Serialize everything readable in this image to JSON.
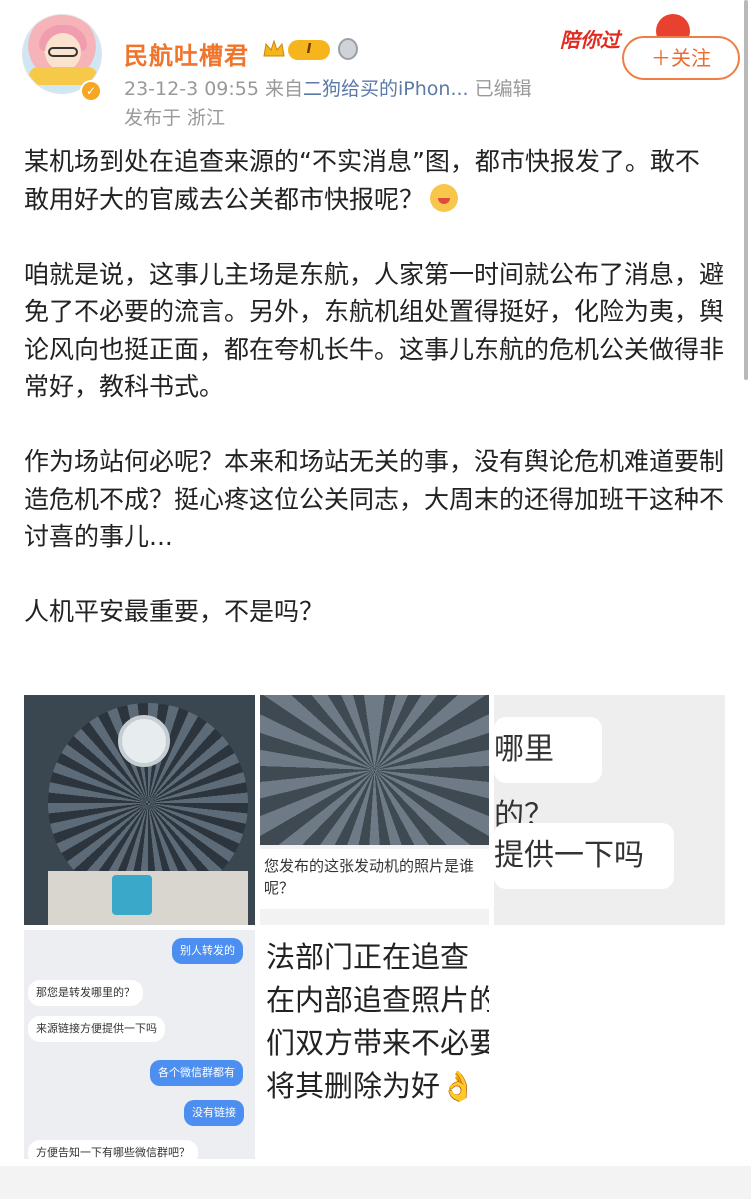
{
  "post": {
    "username": "民航吐槽君",
    "level_badge": "I",
    "date": "23-12-3 09:55",
    "source_prefix": "来自",
    "source_device": "二狗给买的iPhon...",
    "edited": "已编辑",
    "location": "发布于 浙江",
    "promo_text": "陪你过",
    "follow_label": "＋关注",
    "paragraphs": [
      "某机场到处在追查来源的“不实消息”图，都市快报发了。敢不敢用好大的官威去公关都市快报呢？",
      "咱就是说，这事儿主场是东航，人家第一时间就公布了消息，避免了不必要的流言。另外，东航机组处置得挺好，化险为夷，舆论风向也挺正面，都在夸机长牛。这事儿东航的危机公关做得非常好，教科书式。",
      "作为场站何必呢？本来和场站无关的事，没有舆论危机难道要制造危机不成？挺心疼这位公关同志，大周末的还得加班干这种不讨喜的事儿...",
      "人机平安最重要，不是吗？"
    ]
  },
  "images": {
    "img2_caption_line1": "您发布的这张发动机的照片是谁",
    "img2_caption_line2": "呢？",
    "img3_bubble1": "哪里的？",
    "img3_bubble2": "提供一下吗",
    "img4_chat": [
      {
        "side": "right",
        "text": "别人转发的"
      },
      {
        "side": "left",
        "text": "那您是转发哪里的？"
      },
      {
        "side": "left",
        "text": "来源链接方便提供一下吗"
      },
      {
        "side": "right",
        "text": "各个微信群都有"
      },
      {
        "side": "right",
        "text": "没有链接"
      },
      {
        "side": "left",
        "text": "方便告知一下有哪些微信群吧？"
      }
    ],
    "img5_lines": [
      "法部门正在追查",
      "在内部追查照片的",
      "们双方带来不必要",
      "将其删除为好👌"
    ]
  }
}
